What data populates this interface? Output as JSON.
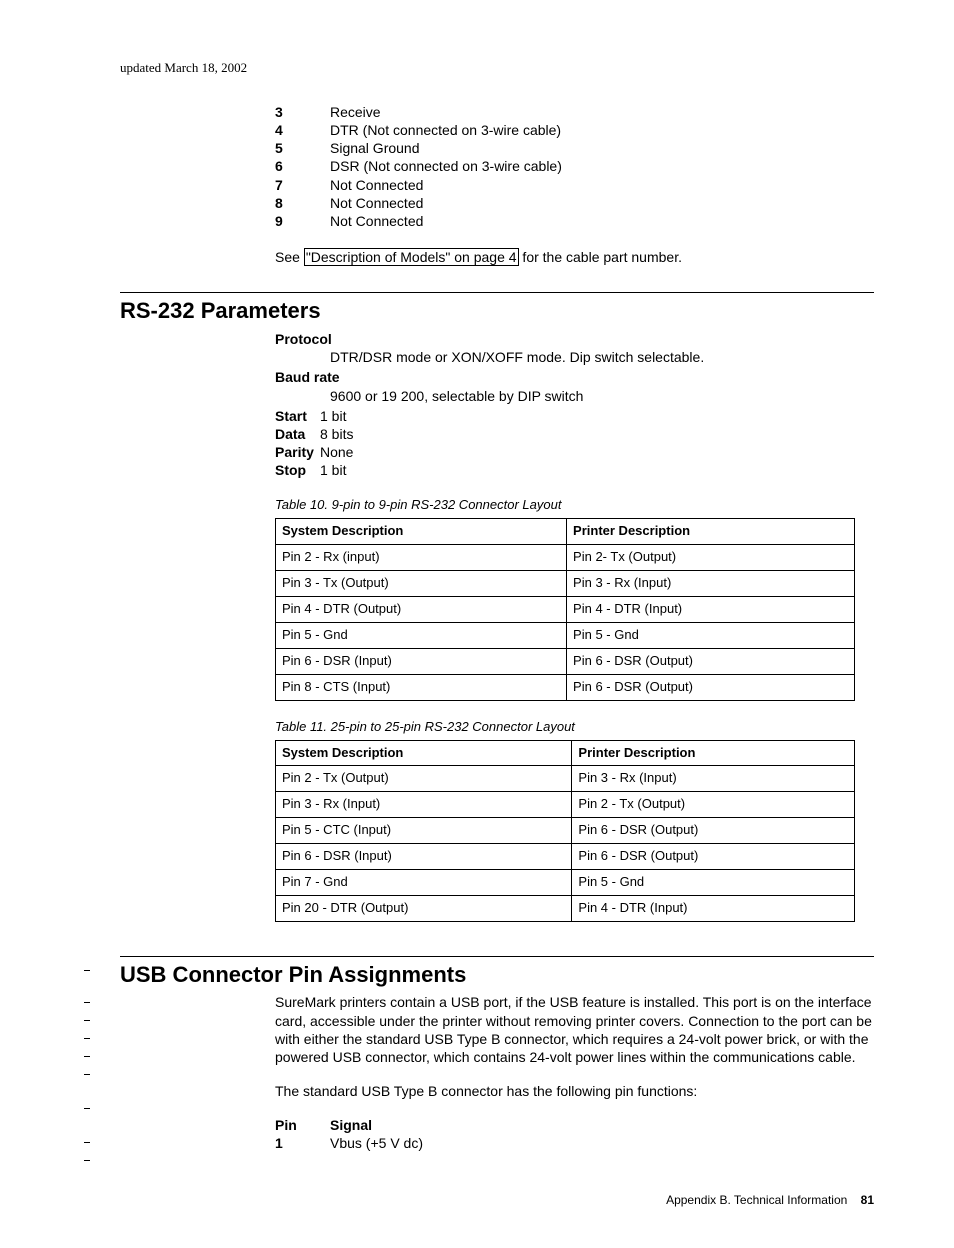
{
  "update_date": "updated March 18, 2002",
  "pins_top": [
    {
      "n": "3",
      "s": "Receive"
    },
    {
      "n": "4",
      "s": "DTR (Not connected on 3-wire cable)"
    },
    {
      "n": "5",
      "s": "Signal Ground"
    },
    {
      "n": "6",
      "s": "DSR (Not connected on 3-wire cable)"
    },
    {
      "n": "7",
      "s": "Not Connected"
    },
    {
      "n": "8",
      "s": "Not Connected"
    },
    {
      "n": "9",
      "s": "Not Connected"
    }
  ],
  "see_note_prefix": "See ",
  "see_note_link": "\"Description of Models\" on page 4",
  "see_note_suffix": " for the cable part number.",
  "rs232": {
    "heading": "RS-232 Parameters",
    "protocol_k": "Protocol",
    "protocol_v": "DTR/DSR mode or XON/XOFF mode. Dip switch selectable.",
    "baud_k": "Baud rate",
    "baud_v": "9600 or 19 200, selectable by DIP switch",
    "start_k": "Start",
    "start_v": "1 bit",
    "data_k": "Data",
    "data_v": "8 bits",
    "parity_k": "Parity",
    "parity_v": "None",
    "stop_k": "Stop",
    "stop_v": "1 bit"
  },
  "table10": {
    "caption": "Table 10. 9-pin to 9-pin RS-232 Connector Layout",
    "h1": "System Description",
    "h2": "Printer Description",
    "rows": [
      [
        "Pin 2 - Rx (input)",
        "Pin 2- Tx (Output)"
      ],
      [
        "Pin 3 - Tx (Output)",
        "Pin 3 - Rx (Input)"
      ],
      [
        "Pin 4 - DTR (Output)",
        "Pin 4 - DTR (Input)"
      ],
      [
        "Pin 5 - Gnd",
        "Pin 5 - Gnd"
      ],
      [
        "Pin 6 - DSR (Input)",
        "Pin 6 - DSR (Output)"
      ],
      [
        "Pin 8 - CTS (Input)",
        "Pin 6 - DSR (Output)"
      ]
    ]
  },
  "table11": {
    "caption": "Table 11. 25-pin to 25-pin RS-232 Connector Layout",
    "h1": "System Description",
    "h2": "Printer Description",
    "rows": [
      [
        "Pin 2 - Tx (Output)",
        "Pin 3 - Rx (Input)"
      ],
      [
        "Pin 3 - Rx (Input)",
        "Pin 2 - Tx (Output)"
      ],
      [
        "Pin 5 - CTC (Input)",
        "Pin 6 - DSR (Output)"
      ],
      [
        "Pin 6 - DSR (Input)",
        "Pin 6 - DSR (Output)"
      ],
      [
        "Pin 7 - Gnd",
        "Pin 5 - Gnd"
      ],
      [
        "Pin 20 - DTR (Output)",
        "Pin 4 - DTR (Input)"
      ]
    ]
  },
  "usb": {
    "heading": "USB Connector Pin Assignments",
    "p1": "SureMark printers contain a USB port, if the USB feature is installed. This port is on the interface card, accessible under the printer without removing printer covers. Connection to the port can be with either the standard USB Type B connector, which requires a 24-volt power brick, or with the powered USB connector, which contains 24-volt power lines within the communications cable.",
    "p2": "The standard USB Type B connector has the following pin functions:",
    "pin_k": "Pin",
    "sig_k": "Signal",
    "pin1_n": "1",
    "pin1_s": "Vbus (+5 V dc)"
  },
  "footer": {
    "appendix": "Appendix B. Technical Information",
    "page": "81"
  }
}
